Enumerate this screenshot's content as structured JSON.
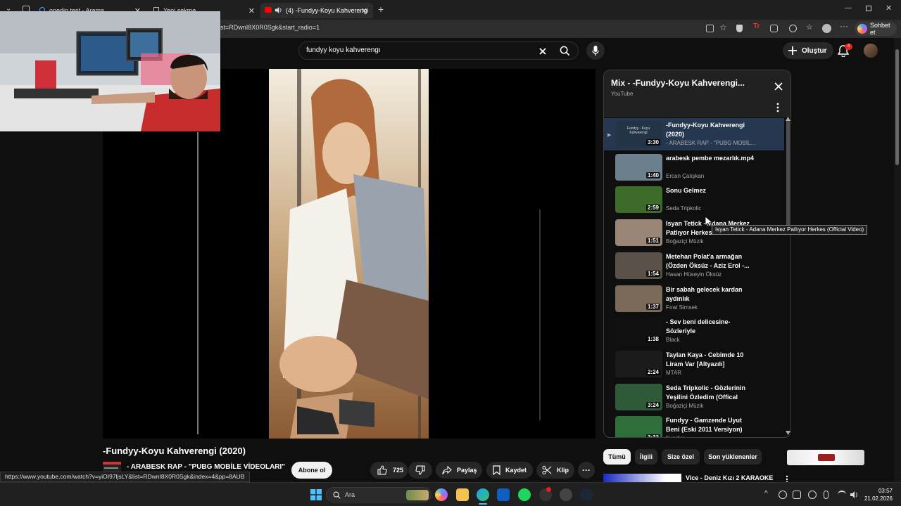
{
  "browser": {
    "tabs": [
      {
        "label": "onedio test - Arama",
        "close": "✕"
      },
      {
        "label": "Yeni sekme",
        "close": "✕"
      },
      {
        "label": "(4) -Fundyy-Koyu Kahverengi",
        "close": "✕"
      }
    ],
    "new_tab": "+",
    "url": "st=RDwnI8X0R0Sgk&start_radio=1",
    "copilot_label": "Sohbet et"
  },
  "youtube": {
    "search_value": "fundyy koyu kahverengı",
    "create_label": "Oluştur",
    "notifications_count": "4"
  },
  "video": {
    "title": "-Fundyy-Koyu Kahverengi (2020)",
    "channel": "- ARABESK RAP - \"PUBG MOBİLE VİDEOLARI\"",
    "subscribe_label": "Abone ol",
    "likes": "725",
    "share_label": "Paylaş",
    "save_label": "Kaydet",
    "clip_label": "Klip"
  },
  "status_url": "https://www.youtube.com/watch?v=yiOI97ljsLY&list=RDwnI8X0R0Sgk&index=4&pp=8AUB",
  "playlist": {
    "title": "Mix - -Fundyy-Koyu Kahverengi...",
    "subtitle": "YouTube",
    "items": [
      {
        "title": "-Fundyy-Koyu Kahverengi (2020)",
        "channel": "- ARABESK RAP - \"PUBG MOBİL...",
        "duration": "3:30",
        "thumb_text": "Fundyy - Koyu Kahverengi",
        "color": "#243447"
      },
      {
        "title": "arabesk pembe mezarlık.mp4",
        "channel": "Ercan Çalışkan",
        "duration": "1:40",
        "color": "#6b7f8c"
      },
      {
        "title": "Sonu Gelmez",
        "channel": "Seda Tripkolic",
        "duration": "2:59",
        "color": "#3d6b2a"
      },
      {
        "title": "Isyan Tetick - Adana Merkez Patlıyor Herkes",
        "channel": "Boğaziçi Müzik",
        "duration": "1:51",
        "color": "#9a8676"
      },
      {
        "title": "Metehan Polat'a armağan (Özden Öksüz - Aziz Erol -...",
        "channel": "Hasan Hüseyin Öksüz",
        "duration": "1:54",
        "color": "#5a5148"
      },
      {
        "title": "Bir sabah gelecek kardan aydınlık",
        "channel": "Fırat Simsek",
        "duration": "1:37",
        "color": "#7a6a5a"
      },
      {
        "title": "- Sev beni delicesine- Sözleriyle",
        "channel": "Black",
        "duration": "1:38",
        "color": "#111111"
      },
      {
        "title": "Taylan Kaya - Cebimde 10 Liram Var [Altyazılı]",
        "channel": "MTAR",
        "duration": "2:24",
        "color": "#1b1b1b"
      },
      {
        "title": "Seda Tripkolic - Gözlerinin Yeşilini Özledim (Offical Video)",
        "channel": "Boğaziçi Müzik",
        "duration": "3:24",
        "color": "#2f5a3a"
      },
      {
        "title": "Fundyy - Gamzende Uyut Beni (Eski 2011 Versiyon)",
        "channel": "Fundyy",
        "duration": "3:32",
        "color": "#2e6e3a"
      }
    ]
  },
  "tooltip": "Isyan Tetick - Adana Merkez Patlıyor Herkes (Official Video)",
  "chips": [
    "Tümü",
    "İlgili",
    "Size özel",
    "Son yüklenenler"
  ],
  "next_video": {
    "title": "Vice - Deniz Kızı 2 KARAOKE"
  },
  "taskbar": {
    "search_placeholder": "Ara",
    "time": "03:57",
    "date": "21.02.2026"
  },
  "colors": {
    "accent_red": "#ff0000",
    "badge_red": "#e62117",
    "current_item_bg": "#263850"
  }
}
